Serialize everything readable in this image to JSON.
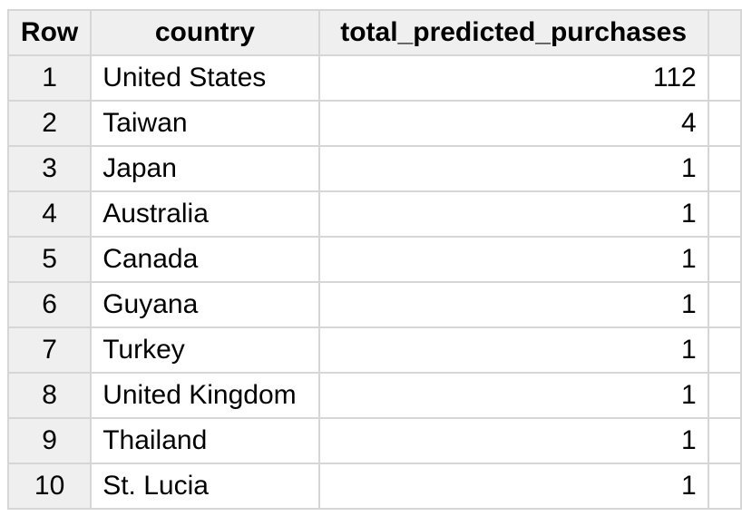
{
  "table": {
    "headers": {
      "row": "Row",
      "country": "country",
      "total": "total_predicted_purchases"
    },
    "rows": [
      {
        "row": "1",
        "country": "United States",
        "total": "112"
      },
      {
        "row": "2",
        "country": "Taiwan",
        "total": "4"
      },
      {
        "row": "3",
        "country": "Japan",
        "total": "1"
      },
      {
        "row": "4",
        "country": "Australia",
        "total": "1"
      },
      {
        "row": "5",
        "country": "Canada",
        "total": "1"
      },
      {
        "row": "6",
        "country": "Guyana",
        "total": "1"
      },
      {
        "row": "7",
        "country": "Turkey",
        "total": "1"
      },
      {
        "row": "8",
        "country": "United Kingdom",
        "total": "1"
      },
      {
        "row": "9",
        "country": "Thailand",
        "total": "1"
      },
      {
        "row": "10",
        "country": "St. Lucia",
        "total": "1"
      }
    ]
  }
}
